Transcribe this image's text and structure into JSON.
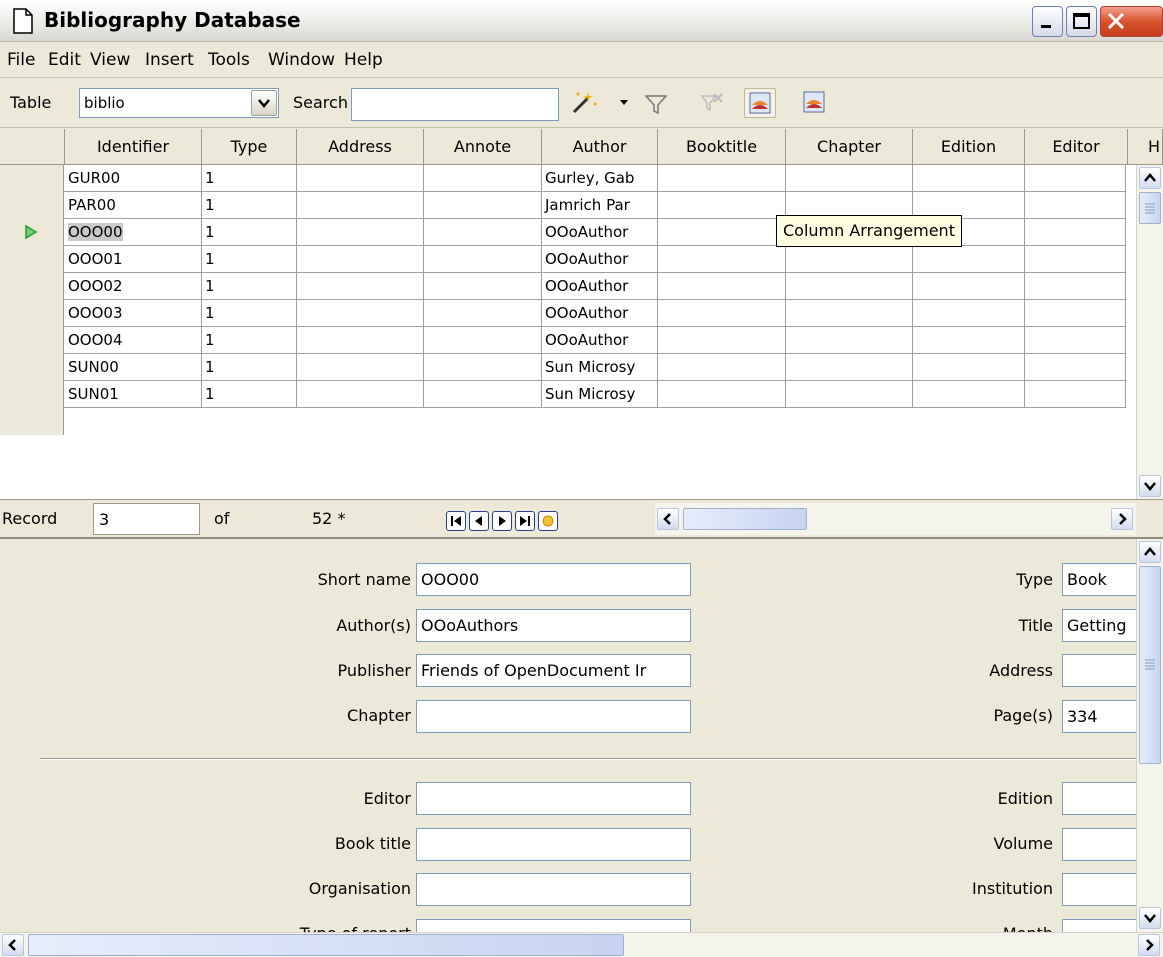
{
  "window": {
    "title": "Bibliography Database"
  },
  "menu": [
    "File",
    "Edit",
    "View",
    "Insert",
    "Tools",
    "Window",
    "Help"
  ],
  "toolbar": {
    "table_label": "Table",
    "table_value": "biblio",
    "search_label": "Search",
    "search_value": ""
  },
  "grid": {
    "columns": [
      "Identifier",
      "Type",
      "Address",
      "Annote",
      "Author",
      "Booktitle",
      "Chapter",
      "Edition",
      "Editor",
      "H"
    ],
    "rows": [
      [
        "GUR00",
        "1",
        "",
        "",
        "Gurley, Gab",
        "",
        "",
        "",
        ""
      ],
      [
        "PAR00",
        "1",
        "",
        "",
        "Jamrich Par",
        "",
        "",
        "",
        ""
      ],
      [
        "OOO00",
        "1",
        "",
        "",
        "OOoAuthor",
        "",
        "",
        "",
        ""
      ],
      [
        "OOO01",
        "1",
        "",
        "",
        "OOoAuthor",
        "",
        "",
        "",
        ""
      ],
      [
        "OOO02",
        "1",
        "",
        "",
        "OOoAuthor",
        "",
        "",
        "",
        ""
      ],
      [
        "OOO03",
        "1",
        "",
        "",
        "OOoAuthor",
        "",
        "",
        "",
        ""
      ],
      [
        "OOO04",
        "1",
        "",
        "",
        "OOoAuthor",
        "",
        "",
        "",
        ""
      ],
      [
        "SUN00",
        "1",
        "",
        "",
        "Sun Microsy",
        "",
        "",
        "",
        ""
      ],
      [
        "SUN01",
        "1",
        "",
        "",
        "Sun Microsy",
        "",
        "",
        "",
        ""
      ]
    ],
    "current_row_index": 2
  },
  "tooltip": "Column Arrangement",
  "navigation": {
    "record_label": "Record",
    "current_record": "3",
    "of_label": "of",
    "total": "52 *"
  },
  "form": {
    "short_name": {
      "label": "Short name",
      "value": "OOO00"
    },
    "authors": {
      "label": "Author(s)",
      "value": "OOoAuthors"
    },
    "publisher": {
      "label": "Publisher",
      "value": "Friends of OpenDocument Ir"
    },
    "chapter": {
      "label": "Chapter",
      "value": ""
    },
    "type": {
      "label": "Type",
      "value": "Book"
    },
    "title": {
      "label": "Title",
      "value": "Getting"
    },
    "address": {
      "label": "Address",
      "value": ""
    },
    "pages": {
      "label": "Page(s)",
      "value": "334"
    },
    "editor": {
      "label": "Editor",
      "value": ""
    },
    "book_title": {
      "label": "Book title",
      "value": ""
    },
    "organisation": {
      "label": "Organisation",
      "value": ""
    },
    "type_of_report": {
      "label": "Type of report",
      "value": ""
    },
    "edition": {
      "label": "Edition",
      "value": ""
    },
    "volume": {
      "label": "Volume",
      "value": ""
    },
    "institution": {
      "label": "Institution",
      "value": ""
    },
    "month": {
      "label": "Month",
      "value": ""
    }
  },
  "colors": {
    "chrome": "#ece9d8",
    "field_border": "#7f9db9",
    "tooltip_bg": "#ffffe1",
    "current_row_marker": "#2e9a2e"
  }
}
